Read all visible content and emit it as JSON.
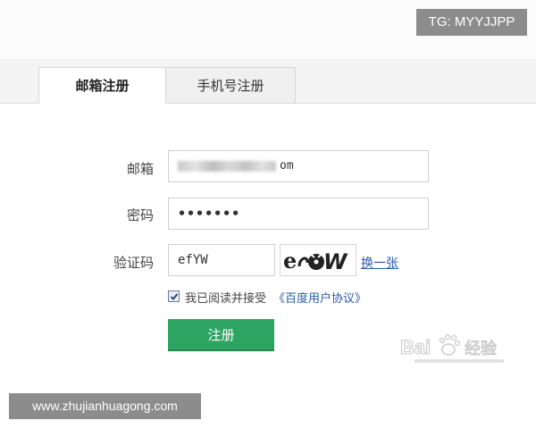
{
  "overlay": {
    "top_badge": "TG: MYYJJPP",
    "bottom_caption": "www.zhujianhuagong.com"
  },
  "tabs": [
    {
      "label": "邮箱注册",
      "active": true
    },
    {
      "label": "手机号注册",
      "active": false
    }
  ],
  "form": {
    "email_label": "邮箱",
    "email_value_suffix": "om",
    "password_label": "密码",
    "password_value": "•••••••",
    "captcha_label": "验证码",
    "captcha_value": "efYW",
    "captcha_image_text": "efYW",
    "captcha_refresh": "换一张"
  },
  "agreement": {
    "checked": true,
    "text": "我已阅读并接受",
    "link": "《百度用户协议》"
  },
  "register_button": "注册",
  "watermark": {
    "text": "Bai",
    "suffix": "经验"
  },
  "colors": {
    "button_green": "#2ea463",
    "link_blue": "#2a5bab"
  }
}
